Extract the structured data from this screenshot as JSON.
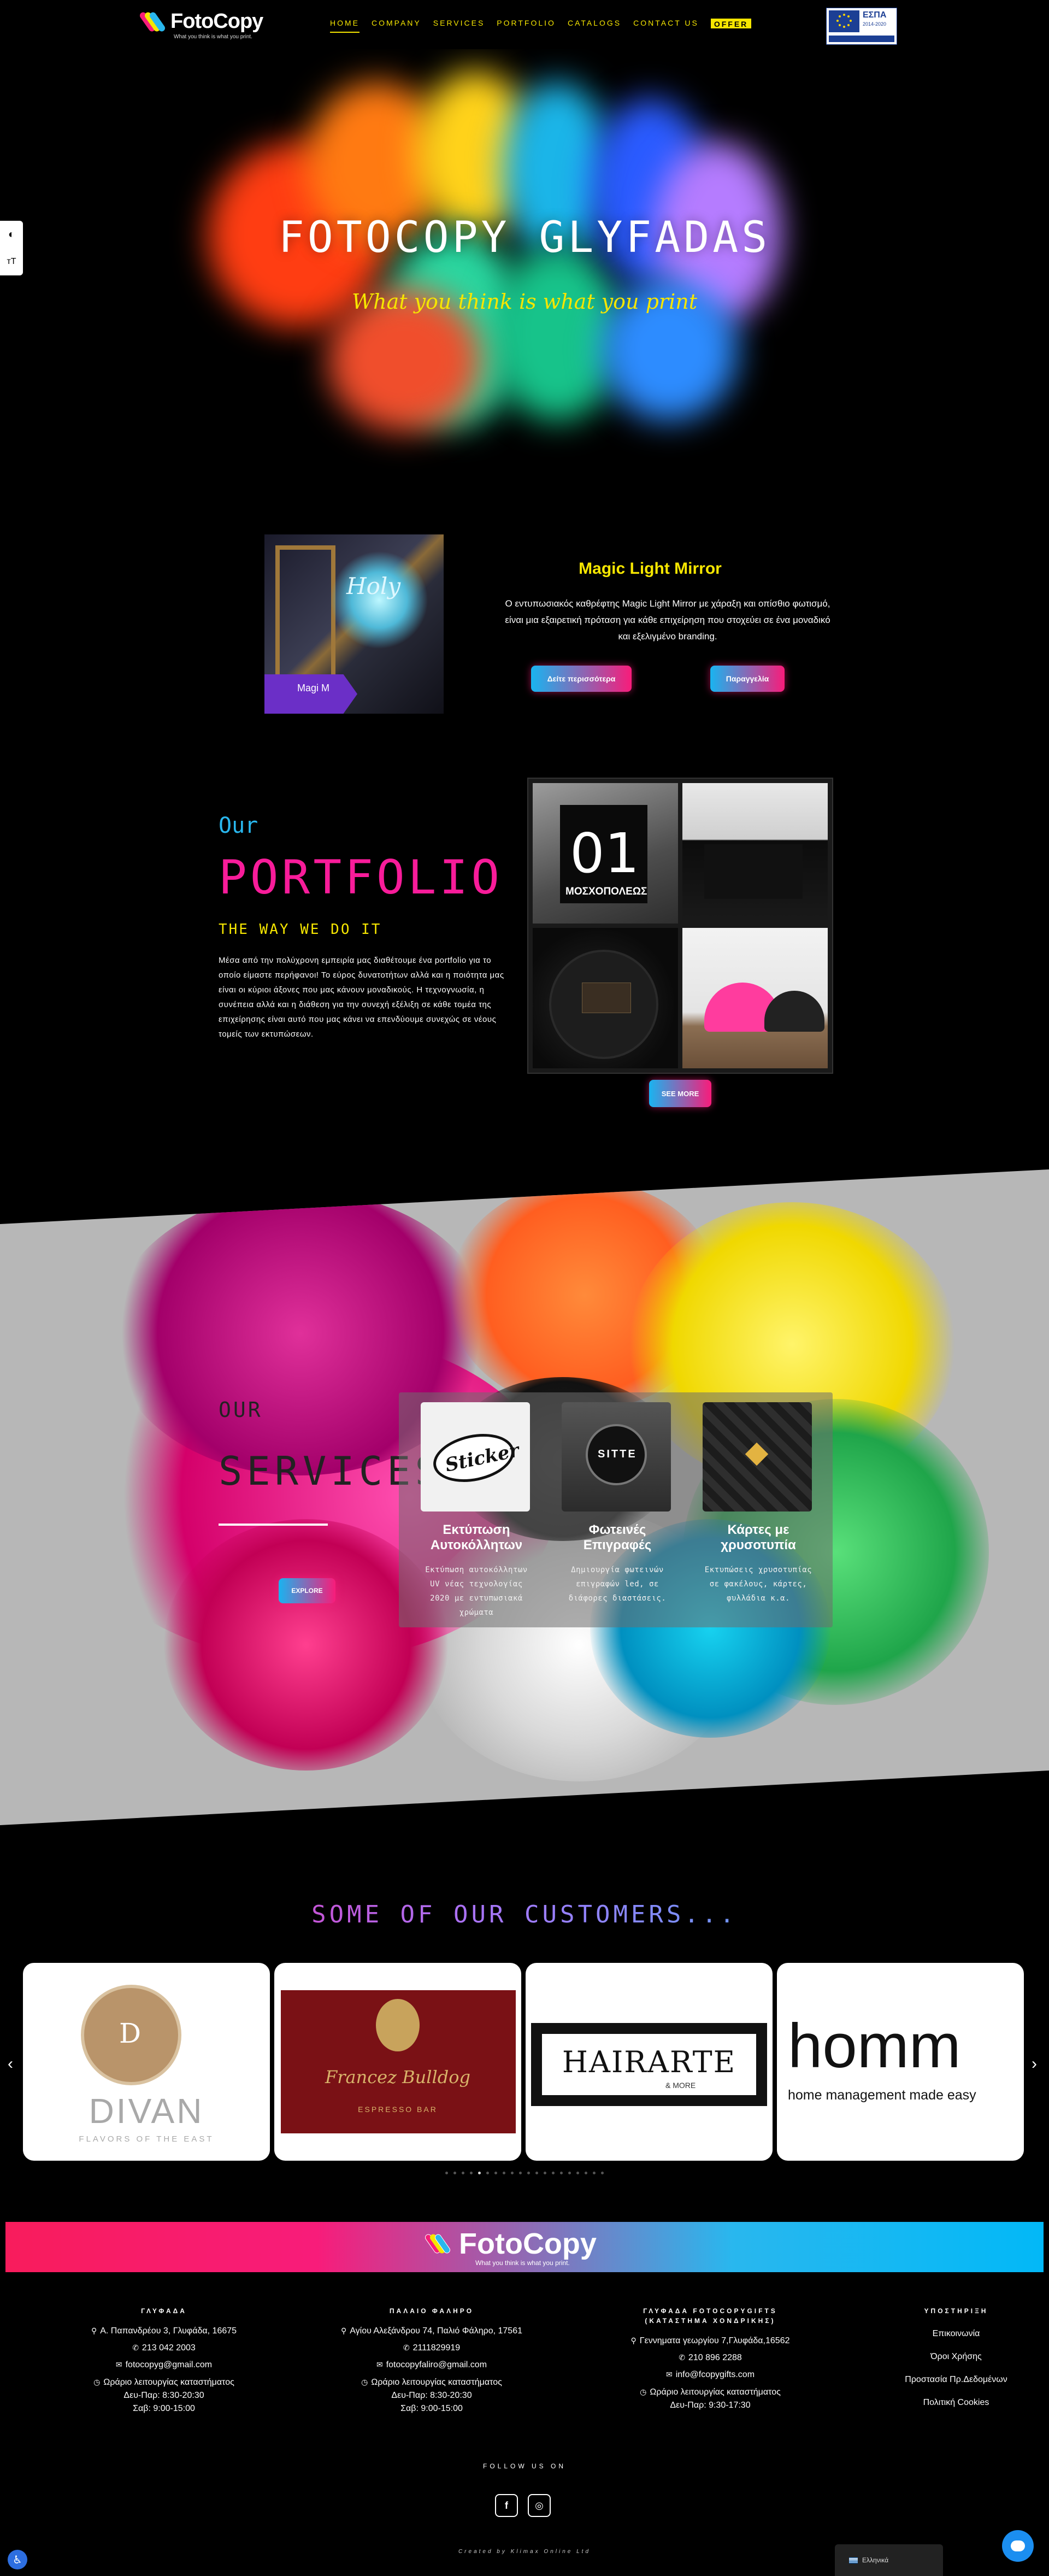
{
  "header": {
    "logo_text": "FotoCopy",
    "logo_tagline": "What you think is what you print.",
    "nav": [
      {
        "label": "HOME",
        "active": true
      },
      {
        "label": "COMPANY"
      },
      {
        "label": "SERVICES"
      },
      {
        "label": "PORTFOLIO"
      },
      {
        "label": "CATALOGS"
      },
      {
        "label": "CONTACT US"
      },
      {
        "label": "OFFER",
        "highlight": true
      }
    ],
    "espa_label": "ΕΣΠΑ",
    "espa_sub": "2014-2020"
  },
  "accessibility": {
    "contrast_icon": "contrast-icon",
    "text_size_icon": "text-size-icon",
    "contrast_glyph": "◐",
    "text_glyph": "тT"
  },
  "hero": {
    "title": "FOTOCOPY GLYFADAS",
    "subtitle": "What you think is what you print"
  },
  "featured": {
    "image_label": "Magic Light Mirror",
    "badge_text": "Magi M",
    "script_text": "Holy",
    "title": "Magic Light Mirror",
    "text": "Ο εντυπωσιακός καθρέφτης Magic Light Mirror με χάραξη και οπίσθιο φωτισμό, είναι μια εξαιρετική πρόταση για κάθε επιχείρηση που στοχεύει σε ένα μοναδικό και εξελιγμένο branding.",
    "button_more": "Δείτε περισσότερα",
    "button_order": "Παραγγελία"
  },
  "portfolio": {
    "our": "Our",
    "title": "PORTFOLIO",
    "subtitle": "THE WAY WE DO IT",
    "text": "Μέσα από την πολύχρονη εμπειρία μας διαθέτουμε ένα portfolio για το οποίο είμαστε περήφανοι! Το εύρος δυνατοτήτων αλλά και η ποιότητα μας είναι οι κύριοι άξονες που μας κάνουν μοναδικούς. Η τεχνογνωσία, η συνέπεια αλλά και η διάθεση για την συνεχή εξέλιξη σε κάθε τομέα της επιχείρησης είναι αυτό που μας κάνει να επενδύουμε συνεχώς σε νέους τομείς των εκτυπώσεων.",
    "sign_number": "01",
    "sign_text": "ΜΟΣΧΟΠΟΛΕΩΣ",
    "see_more": "SEE MORE"
  },
  "services": {
    "our": "OUR",
    "title": "SERVICES",
    "explore": "EXPLORE",
    "cards": [
      {
        "title": "Εκτύπωση Αυτοκόλλητων",
        "text": "Εκτύπωση αυτοκόλλητων UV νέας τεχνολογίας 2020 με εντυπωσιακά χρώματα",
        "image_label": "Sticker"
      },
      {
        "title": "Φωτεινές Επιγραφές",
        "text": "Δημιουργία φωτεινών επιγραφών led, σε διάφορες διαστάσεις.",
        "image_label": "SITTE"
      },
      {
        "title": "Κάρτες με χρυσοτυπία",
        "text": "Εκτυπώσεις χρυσοτυπίας σε φακέλους, κάρτες, φυλλάδια κ.α.",
        "image_label": ""
      }
    ]
  },
  "customers": {
    "title": "SOME OF OUR CUSTOMERS...",
    "logos": [
      {
        "name": "DIVAN",
        "sub": "FLAVORS OF THE EAST",
        "mono": "D"
      },
      {
        "name": "Francez Bulldog",
        "sub": "ESPRESSO BAR"
      },
      {
        "name": "HAIRARTE",
        "sub": "& MORE"
      },
      {
        "name": "homm",
        "sub": "home management made easy"
      }
    ],
    "dots_count": 20,
    "active_dot": 4
  },
  "footer": {
    "logo_text": "FotoCopy",
    "logo_tagline": "What you think is what you print.",
    "columns": [
      {
        "title": "ΓΛΥΦΑΔΑ",
        "address": "Α. Παπανδρέου 3, Γλυφάδα, 16675",
        "phone": "213 042 2003",
        "email": "fotocopyg@gmail.com",
        "hours_label": "Ωράριο λειτουργίας καταστήματος",
        "hours1": "Δευ-Παρ: 8:30-20:30",
        "hours2": "Σαβ: 9:00-15:00"
      },
      {
        "title": "ΠΑΛΑΙΟ ΦΑΛΗΡΟ",
        "address": "Αγίου Αλεξάνδρου 74, Παλιό Φάληρο, 17561",
        "phone": "2111829919",
        "email": "fotocopyfaliro@gmail.com",
        "hours_label": "Ωράριο λειτουργίας καταστήματος",
        "hours1": "Δευ-Παρ: 8:30-20:30",
        "hours2": "Σαβ: 9:00-15:00"
      },
      {
        "title": "ΓΛΥΦΑΔΑ FOTOCOPYGIFTS",
        "title2": "(ΚΑΤΑΣΤΗΜΑ ΧΟΝΔΡΙΚΗΣ)",
        "address": "Γεννηματα γεωργίου 7,Γλυφάδα,16562",
        "phone": "210 896 2288",
        "email": "info@fcopygifts.com",
        "hours_label": "Ωράριο λειτουργίας καταστήματος",
        "hours1": "Δευ-Παρ: 9:30-17:30"
      },
      {
        "title": "ΥΠΟΣΤΗΡΙΞΗ",
        "links": [
          "Επικοινωνία",
          "Όροι Χρήσης",
          "Προστασία Πρ.Δεδομένων",
          "Πολιτική Cookies"
        ]
      }
    ],
    "follow": "FOLLOW US ON",
    "social": [
      {
        "icon": "facebook-icon",
        "glyph": "f"
      },
      {
        "icon": "instagram-icon",
        "glyph": "◎"
      }
    ],
    "credit": "Created by Klimax Online Ltd",
    "language": "Ελληνικά"
  },
  "colors": {
    "accent_yellow": "#f6e600",
    "accent_pink": "#f81c9a",
    "accent_blue": "#29b7ee"
  }
}
